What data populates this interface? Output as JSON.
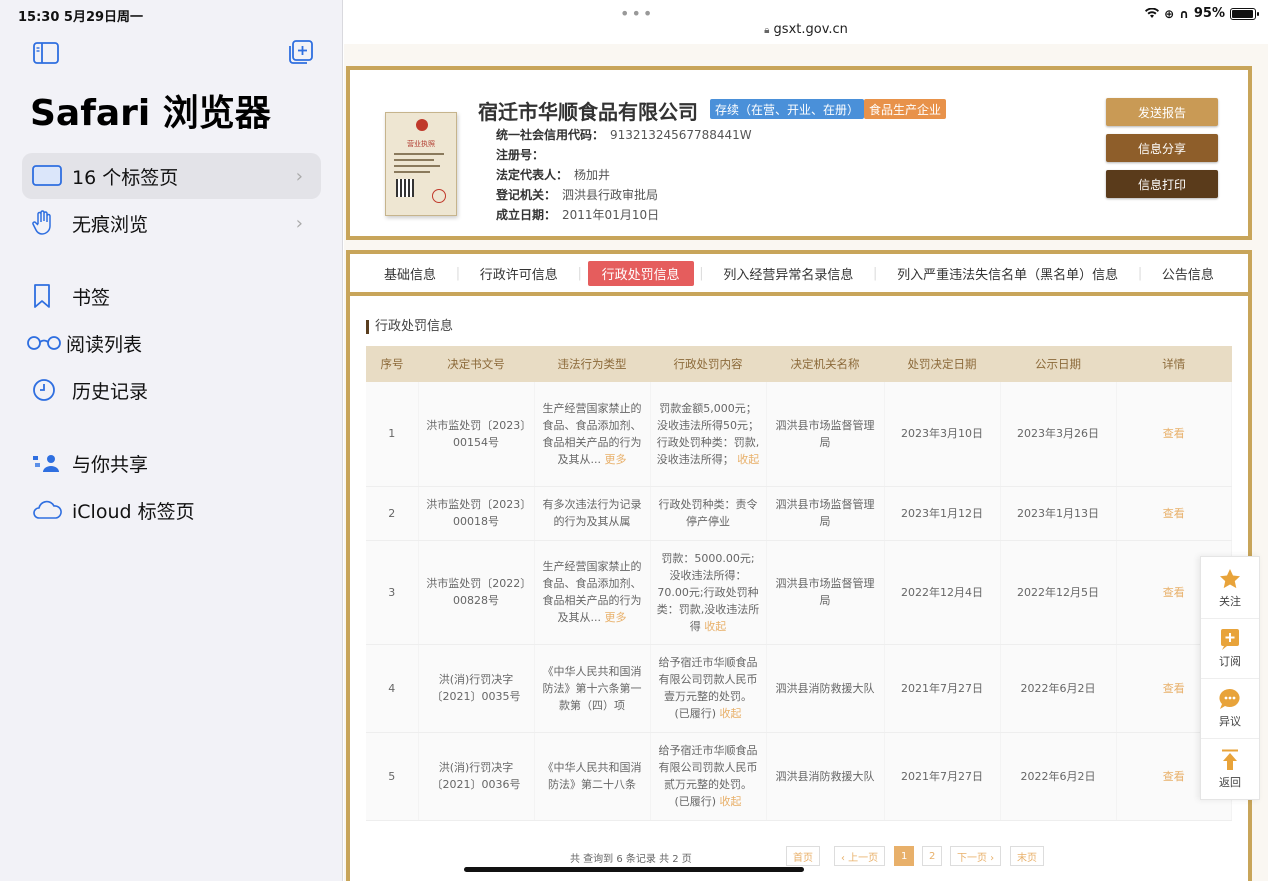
{
  "status": {
    "time": "15:30  5月29日周一",
    "battery": "95%",
    "battery_level": 0.95
  },
  "sidebar": {
    "title": "Safari 浏览器",
    "items": [
      {
        "label": "16 个标签页",
        "icon": "tabs-icon",
        "chevron": "›"
      },
      {
        "label": "无痕浏览",
        "icon": "hand-icon",
        "chevron": "›"
      },
      {
        "label": "书签",
        "icon": "bookmark-icon"
      },
      {
        "label": "阅读列表",
        "icon": "glasses-icon"
      },
      {
        "label": "历史记录",
        "icon": "clock-icon"
      },
      {
        "label": "与你共享",
        "icon": "shared-icon"
      },
      {
        "label": "iCloud 标签页",
        "icon": "cloud-icon"
      }
    ]
  },
  "browser": {
    "dots": "•••",
    "url": "gsxt.gov.cn"
  },
  "company": {
    "license_heading": "营业执照",
    "name": "宿迁市华顺食品有限公司",
    "status_badge": "存续（在营、开业、在册）",
    "type_badge": "食品生产企业",
    "fields": [
      {
        "label": "统一社会信用代码：",
        "value": "91321324567788441W"
      },
      {
        "label": "注册号：",
        "value": ""
      },
      {
        "label": "法定代表人：",
        "value": "杨加井"
      },
      {
        "label": "登记机关：",
        "value": "泗洪县行政审批局"
      },
      {
        "label": "成立日期：",
        "value": "2011年01月10日"
      }
    ],
    "actions": [
      "发送报告",
      "信息分享",
      "信息打印"
    ]
  },
  "tabs": [
    "基础信息",
    "行政许可信息",
    "行政处罚信息",
    "列入经营异常名录信息",
    "列入严重违法失信名单（黑名单）信息",
    "公告信息"
  ],
  "section_title": "行政处罚信息",
  "table": {
    "headers": [
      "序号",
      "决定书文号",
      "违法行为类型",
      "行政处罚内容",
      "决定机关名称",
      "处罚决定日期",
      "公示日期",
      "详情"
    ],
    "rows": [
      {
        "no": "1",
        "doc": "洪市监处罚〔2023〕00154号",
        "type": "生产经营国家禁止的食品、食品添加剂、食品相关产品的行为及其从...",
        "type_more": "更多",
        "content": "罚款金额5,000元；没收违法所得50元；行政处罚种类：罚款,没收违法所得；",
        "content_more": "收起",
        "org": "泗洪县市场监督管理局",
        "date": "2023年3月10日",
        "pub": "2023年3月26日",
        "detail": "查看"
      },
      {
        "no": "2",
        "doc": "洪市监处罚〔2023〕00018号",
        "type": "有多次违法行为记录的行为及其从属",
        "type_more": "",
        "content": "行政处罚种类：责令停产停业",
        "content_more": "",
        "org": "泗洪县市场监督管理局",
        "date": "2023年1月12日",
        "pub": "2023年1月13日",
        "detail": "查看"
      },
      {
        "no": "3",
        "doc": "洪市监处罚〔2022〕00828号",
        "type": "生产经营国家禁止的食品、食品添加剂、食品相关产品的行为及其从...",
        "type_more": "更多",
        "content": "罚款：5000.00元;没收违法所得：70.00元;行政处罚种类：罚款,没收违法所得",
        "content_more": "收起",
        "org": "泗洪县市场监督管理局",
        "date": "2022年12月4日",
        "pub": "2022年12月5日",
        "detail": "查看"
      },
      {
        "no": "4",
        "doc": "洪(消)行罚决字〔2021〕0035号",
        "type": "《中华人民共和国消防法》第十六条第一款第（四）项",
        "type_more": "",
        "content": "给予宿迁市华顺食品有限公司罚款人民币壹万元整的处罚。(已履行)",
        "content_more": "收起",
        "org": "泗洪县消防救援大队",
        "date": "2021年7月27日",
        "pub": "2022年6月2日",
        "detail": "查看"
      },
      {
        "no": "5",
        "doc": "洪(消)行罚决字〔2021〕0036号",
        "type": "《中华人民共和国消防法》第二十八条",
        "type_more": "",
        "content": "给予宿迁市华顺食品有限公司罚款人民币贰万元整的处罚。(已履行)",
        "content_more": "收起",
        "org": "泗洪县消防救援大队",
        "date": "2021年7月27日",
        "pub": "2022年6月2日",
        "detail": "查看"
      }
    ]
  },
  "pager": {
    "total": "共 查询到 6 条记录 共 2 页",
    "first": "首页",
    "prev": "‹ 上一页",
    "p1": "1",
    "p2": "2",
    "next": "下一页 ›",
    "last": "末页"
  },
  "float_panel": [
    {
      "label": "关注",
      "icon": "star-icon",
      "color": "#e8a33a"
    },
    {
      "label": "订阅",
      "icon": "subscribe-icon",
      "color": "#e8a33a"
    },
    {
      "label": "异议",
      "icon": "chat-icon",
      "color": "#e8a33a"
    },
    {
      "label": "返回",
      "icon": "arrow-up-icon",
      "color": "#e8a33a"
    }
  ]
}
